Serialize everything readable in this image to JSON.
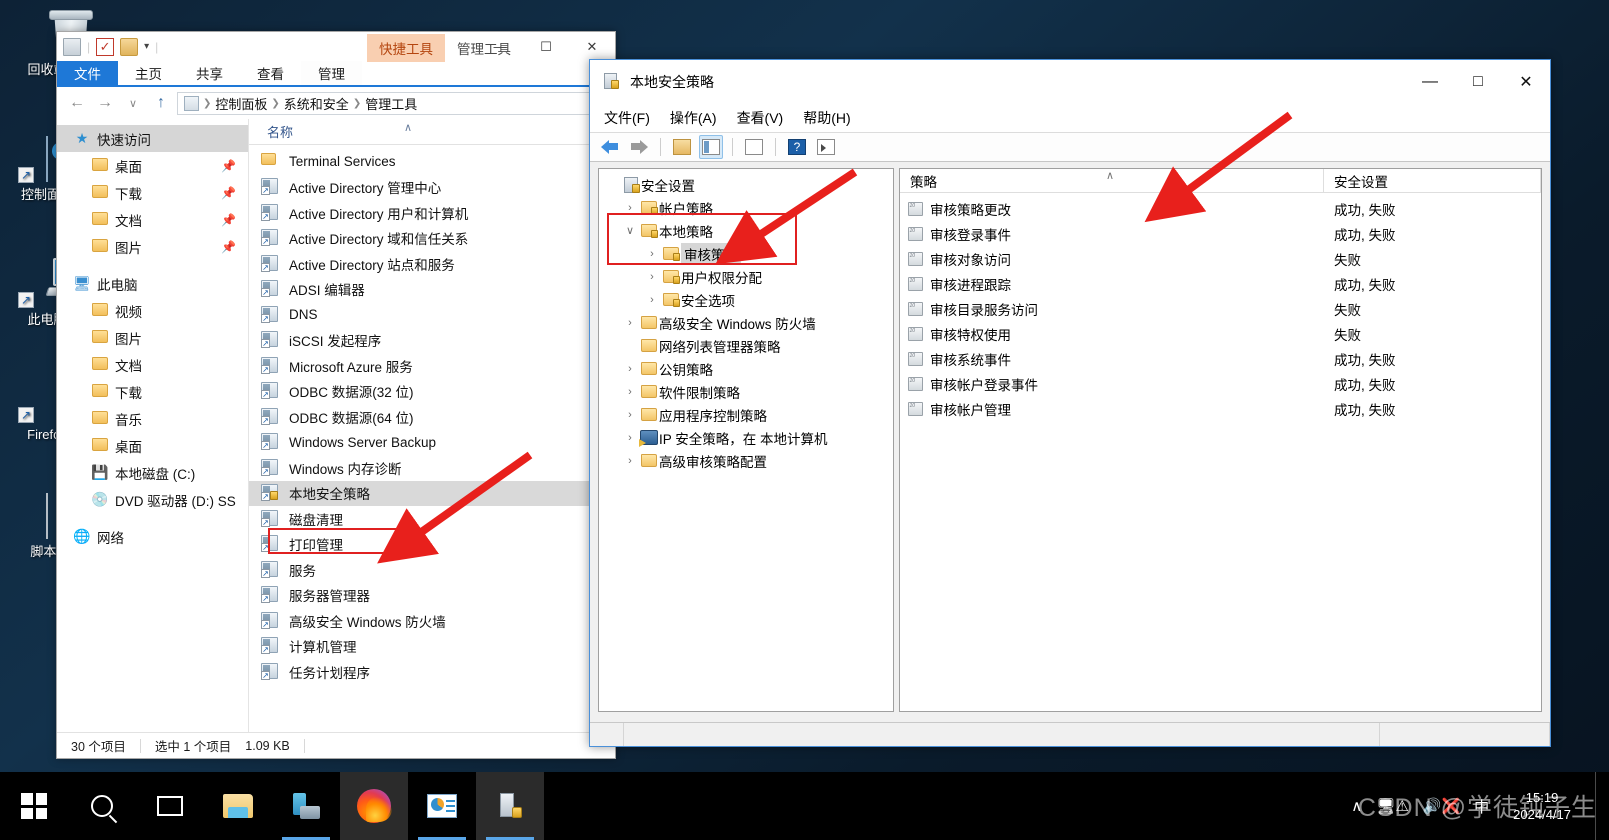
{
  "desktop": {
    "icons": [
      {
        "label": "回收站",
        "icon": "recycle-bin-icon",
        "shortcut": false
      },
      {
        "label": "控制面板",
        "icon": "control-panel-icon",
        "shortcut": true
      },
      {
        "label": "此电脑",
        "icon": "this-pc-icon",
        "shortcut": true
      },
      {
        "label": "Firefox",
        "icon": "firefox-icon",
        "shortcut": true
      },
      {
        "label": "脚本.t",
        "icon": "text-document-icon",
        "shortcut": false
      }
    ]
  },
  "explorer": {
    "quick_access_toolbar": {
      "properties_icon": "properties-icon",
      "check_icon": "check-box-icon",
      "panel_icon": "panel-icon",
      "dropdown_icon": "chevron-down-icon"
    },
    "contextual_header": {
      "title": "快捷工具",
      "subtitle": "管理工具"
    },
    "window_buttons": {
      "minimize": "—",
      "maximize": "☐",
      "close": "✕"
    },
    "tabs": [
      {
        "label": "文件",
        "active": true
      },
      {
        "label": "主页",
        "active": false
      },
      {
        "label": "共享",
        "active": false
      },
      {
        "label": "查看",
        "active": false
      },
      {
        "label": "管理",
        "active": false,
        "contextual": true
      }
    ],
    "nav_buttons": {
      "back": "←",
      "forward": "→",
      "recent": "∨",
      "up": "↑"
    },
    "breadcrumb": [
      "控制面板",
      "系统和安全",
      "管理工具"
    ],
    "sidebar": [
      {
        "label": "快速访问",
        "icon": "star-pin-icon",
        "level": 0,
        "selected": true,
        "pinned": false
      },
      {
        "label": "桌面",
        "icon": "desktop-folder-icon",
        "level": 1,
        "pinned": true
      },
      {
        "label": "下载",
        "icon": "downloads-folder-icon",
        "level": 1,
        "pinned": true
      },
      {
        "label": "文档",
        "icon": "documents-folder-icon",
        "level": 1,
        "pinned": true
      },
      {
        "label": "图片",
        "icon": "pictures-folder-icon",
        "level": 1,
        "pinned": true
      },
      {
        "label": "此电脑",
        "icon": "this-pc-icon",
        "level": 0,
        "pinned": false
      },
      {
        "label": "视频",
        "icon": "videos-folder-icon",
        "level": 1,
        "pinned": false
      },
      {
        "label": "图片",
        "icon": "pictures-folder-icon",
        "level": 1,
        "pinned": false
      },
      {
        "label": "文档",
        "icon": "documents-folder-icon",
        "level": 1,
        "pinned": false
      },
      {
        "label": "下载",
        "icon": "downloads-folder-icon",
        "level": 1,
        "pinned": false
      },
      {
        "label": "音乐",
        "icon": "music-folder-icon",
        "level": 1,
        "pinned": false
      },
      {
        "label": "桌面",
        "icon": "desktop-folder-icon",
        "level": 1,
        "pinned": false
      },
      {
        "label": "本地磁盘 (C:)",
        "icon": "local-disk-icon",
        "level": 1,
        "pinned": false
      },
      {
        "label": "DVD 驱动器 (D:) SS",
        "icon": "dvd-drive-icon",
        "level": 1,
        "pinned": false
      },
      {
        "label": "网络",
        "icon": "network-icon",
        "level": 0,
        "pinned": false
      }
    ],
    "column_header": {
      "name": "名称",
      "sort_indicator": "∧"
    },
    "files": [
      {
        "name": "Terminal Services",
        "icon": "folder-icon",
        "selected": false
      },
      {
        "name": "Active Directory 管理中心",
        "icon": "mmc-shortcut-icon",
        "selected": false
      },
      {
        "name": "Active Directory 用户和计算机",
        "icon": "mmc-shortcut-icon",
        "selected": false
      },
      {
        "name": "Active Directory 域和信任关系",
        "icon": "mmc-shortcut-icon",
        "selected": false
      },
      {
        "name": "Active Directory 站点和服务",
        "icon": "mmc-shortcut-icon",
        "selected": false
      },
      {
        "name": "ADSI 编辑器",
        "icon": "mmc-shortcut-icon",
        "selected": false
      },
      {
        "name": "DNS",
        "icon": "mmc-shortcut-icon",
        "selected": false
      },
      {
        "name": "iSCSI 发起程序",
        "icon": "mmc-shortcut-icon",
        "selected": false
      },
      {
        "name": "Microsoft Azure 服务",
        "icon": "mmc-shortcut-icon",
        "selected": false
      },
      {
        "name": "ODBC 数据源(32 位)",
        "icon": "mmc-shortcut-icon",
        "selected": false
      },
      {
        "name": "ODBC 数据源(64 位)",
        "icon": "mmc-shortcut-icon",
        "selected": false
      },
      {
        "name": "Windows Server Backup",
        "icon": "mmc-shortcut-icon",
        "selected": false
      },
      {
        "name": "Windows 内存诊断",
        "icon": "mmc-shortcut-icon",
        "selected": false
      },
      {
        "name": "本地安全策略",
        "icon": "mmc-lock-shortcut-icon",
        "selected": true
      },
      {
        "name": "磁盘清理",
        "icon": "mmc-shortcut-icon",
        "selected": false
      },
      {
        "name": "打印管理",
        "icon": "mmc-shortcut-icon",
        "selected": false
      },
      {
        "name": "服务",
        "icon": "mmc-shortcut-icon",
        "selected": false
      },
      {
        "name": "服务器管理器",
        "icon": "mmc-shortcut-icon",
        "selected": false
      },
      {
        "name": "高级安全 Windows 防火墙",
        "icon": "mmc-shortcut-icon",
        "selected": false
      },
      {
        "name": "计算机管理",
        "icon": "mmc-shortcut-icon",
        "selected": false
      },
      {
        "name": "任务计划程序",
        "icon": "mmc-shortcut-icon",
        "selected": false
      }
    ],
    "status": {
      "count": "30 个项目",
      "selection": "选中 1 个项目",
      "size": "1.09 KB"
    }
  },
  "mmc": {
    "title": "本地安全策略",
    "title_icon": "security-policy-icon",
    "window_buttons": {
      "minimize": "—",
      "maximize": "□",
      "close": "✕"
    },
    "menus": [
      "文件(F)",
      "操作(A)",
      "查看(V)",
      "帮助(H)"
    ],
    "toolbar": [
      {
        "icon": "back-arrow-icon",
        "active": false
      },
      {
        "icon": "forward-arrow-icon",
        "active": false
      },
      {
        "icon": "up-folder-icon",
        "active": false
      },
      {
        "icon": "show-hide-console-tree-icon",
        "active": true
      },
      {
        "icon": "export-list-icon",
        "active": false
      },
      {
        "icon": "help-icon",
        "active": false
      },
      {
        "icon": "run-icon",
        "active": false
      }
    ],
    "tree": [
      {
        "label": "安全设置",
        "icon": "security-settings-icon",
        "indent": 0,
        "twisty": "",
        "selected": false
      },
      {
        "label": "帐户策略",
        "icon": "secure-folder-icon",
        "indent": 1,
        "twisty": "›",
        "selected": false
      },
      {
        "label": "本地策略",
        "icon": "secure-folder-icon",
        "indent": 1,
        "twisty": "∨",
        "selected": false
      },
      {
        "label": "审核策略",
        "icon": "secure-folder-icon",
        "indent": 2,
        "twisty": "›",
        "selected": true
      },
      {
        "label": "用户权限分配",
        "icon": "secure-folder-icon",
        "indent": 2,
        "twisty": "›",
        "selected": false
      },
      {
        "label": "安全选项",
        "icon": "secure-folder-icon",
        "indent": 2,
        "twisty": "›",
        "selected": false
      },
      {
        "label": "高级安全 Windows 防火墙",
        "icon": "folder-icon",
        "indent": 1,
        "twisty": "›",
        "selected": false
      },
      {
        "label": "网络列表管理器策略",
        "icon": "folder-icon",
        "indent": 1,
        "twisty": "",
        "selected": false
      },
      {
        "label": "公钥策略",
        "icon": "folder-icon",
        "indent": 1,
        "twisty": "›",
        "selected": false
      },
      {
        "label": "软件限制策略",
        "icon": "folder-icon",
        "indent": 1,
        "twisty": "›",
        "selected": false
      },
      {
        "label": "应用程序控制策略",
        "icon": "folder-icon",
        "indent": 1,
        "twisty": "›",
        "selected": false
      },
      {
        "label": "IP 安全策略，在 本地计算机",
        "icon": "ipsec-icon",
        "indent": 1,
        "twisty": "›",
        "selected": false
      },
      {
        "label": "高级审核策略配置",
        "icon": "folder-icon",
        "indent": 1,
        "twisty": "›",
        "selected": false
      }
    ],
    "columns": {
      "policy": "策略",
      "setting": "安全设置",
      "sort_indicator": "∧"
    },
    "policies": [
      {
        "name": "审核策略更改",
        "setting": "成功, 失败",
        "icon": "policy-icon"
      },
      {
        "name": "审核登录事件",
        "setting": "成功, 失败",
        "icon": "policy-icon"
      },
      {
        "name": "审核对象访问",
        "setting": "失败",
        "icon": "policy-icon"
      },
      {
        "name": "审核进程跟踪",
        "setting": "成功, 失败",
        "icon": "policy-icon"
      },
      {
        "name": "审核目录服务访问",
        "setting": "失败",
        "icon": "policy-icon"
      },
      {
        "name": "审核特权使用",
        "setting": "失败",
        "icon": "policy-icon"
      },
      {
        "name": "审核系统事件",
        "setting": "成功, 失败",
        "icon": "policy-icon"
      },
      {
        "name": "审核帐户登录事件",
        "setting": "成功, 失败",
        "icon": "policy-icon"
      },
      {
        "name": "审核帐户管理",
        "setting": "成功, 失败",
        "icon": "policy-icon"
      }
    ]
  },
  "taskbar": {
    "items": [
      {
        "icon": "windows-start-icon",
        "name": "start-button",
        "running": false,
        "active": false
      },
      {
        "icon": "search-icon",
        "name": "search-button",
        "running": false,
        "active": false
      },
      {
        "icon": "task-view-icon",
        "name": "task-view-button",
        "running": false,
        "active": false
      },
      {
        "icon": "file-explorer-icon",
        "name": "taskbar-file-explorer",
        "running": false,
        "active": false
      },
      {
        "icon": "server-manager-icon",
        "name": "taskbar-server-manager",
        "running": true,
        "active": false
      },
      {
        "icon": "firefox-icon",
        "name": "taskbar-firefox",
        "running": false,
        "active": true
      },
      {
        "icon": "control-panel-icon",
        "name": "taskbar-control-panel",
        "running": true,
        "active": false
      },
      {
        "icon": "local-security-policy-icon",
        "name": "taskbar-local-security-policy",
        "running": true,
        "active": true
      }
    ],
    "tray": {
      "chevron": "∧",
      "network_icon": "network-warning-icon",
      "volume_icon": "volume-muted-icon",
      "ime_label": "中"
    },
    "clock": {
      "time": "15:19",
      "date": "2024/4/17"
    }
  },
  "watermark": "CSDN @学徒钝子生",
  "colors": {
    "accent": "#1e78d7",
    "contextual_tab": "#f9cfb1",
    "annotation_red": "#e02020",
    "selection_gray": "#d6d6d6",
    "taskbar": "#000000"
  }
}
